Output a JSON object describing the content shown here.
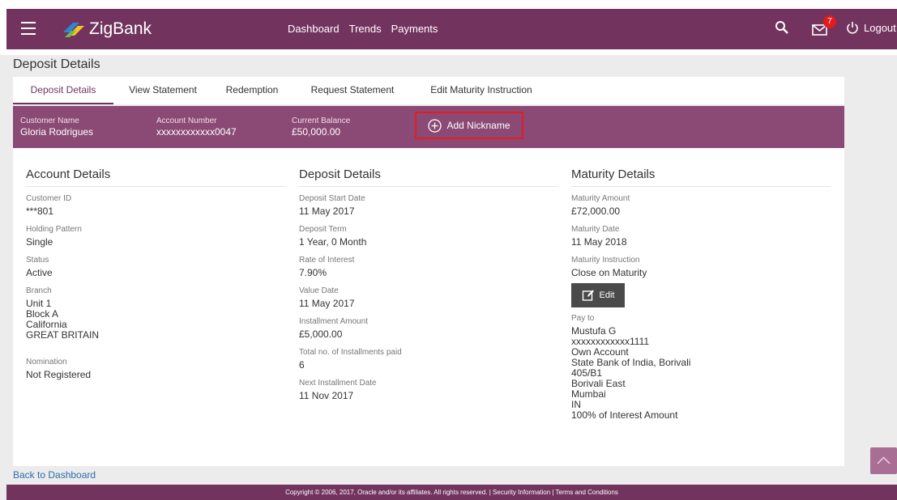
{
  "header": {
    "app_name": "ZigBank",
    "nav": [
      "Dashboard",
      "Trends",
      "Payments"
    ],
    "mail_badge": "7",
    "logout_label": "Logout",
    "brand_color": "#72345e"
  },
  "page_title": "Deposit Details",
  "tabs": [
    {
      "label": "Deposit Details",
      "active": true
    },
    {
      "label": "View Statement",
      "active": false
    },
    {
      "label": "Redemption",
      "active": false
    },
    {
      "label": "Request Statement",
      "active": false
    },
    {
      "label": "Edit Maturity Instruction",
      "active": false
    }
  ],
  "summary": {
    "customer_name_label": "Customer Name",
    "customer_name": "Gloria Rodrigues",
    "account_number_label": "Account Number",
    "account_number": "xxxxxxxxxxxx0047",
    "balance_label": "Current Balance",
    "balance": "£50,000.00",
    "add_nickname": "Add Nickname"
  },
  "account_details": {
    "title": "Account Details",
    "fields": [
      {
        "label": "Customer ID",
        "value": "***801"
      },
      {
        "label": "Holding Pattern",
        "value": "Single"
      },
      {
        "label": "Status",
        "value": "Active"
      }
    ],
    "branch_label": "Branch",
    "branch_lines": [
      "Unit 1",
      "Block A",
      "California",
      "GREAT BRITAIN"
    ],
    "nomination_label": "Nomination",
    "nomination": "Not Registered"
  },
  "deposit_details": {
    "title": "Deposit Details",
    "fields": [
      {
        "label": "Deposit Start Date",
        "value": "11 May 2017"
      },
      {
        "label": "Deposit Term",
        "value": "1 Year, 0 Month"
      },
      {
        "label": "Rate of Interest",
        "value": "7.90%"
      },
      {
        "label": "Value Date",
        "value": "11 May 2017"
      },
      {
        "label": "Installment Amount",
        "value": "£5,000.00"
      },
      {
        "label": "Total no. of Installments paid",
        "value": "6"
      },
      {
        "label": "Next Installment Date",
        "value": "11 Nov 2017"
      }
    ]
  },
  "maturity_details": {
    "title": "Maturity Details",
    "fields": [
      {
        "label": "Maturity Amount",
        "value": "£72,000.00"
      },
      {
        "label": "Maturity Date",
        "value": "11 May 2018"
      },
      {
        "label": "Maturity Instruction",
        "value": "Close on Maturity"
      }
    ],
    "edit_label": "Edit",
    "pay_to_label": "Pay to",
    "pay_to_lines": [
      "Mustufa G",
      "xxxxxxxxxxxx1111",
      "Own Account",
      "State Bank of India, Borivali",
      "405/B1",
      "Borivali East",
      "Mumbai",
      "IN",
      "100% of Interest Amount"
    ]
  },
  "back_link": "Back to Dashboard",
  "footer": "Copyright © 2006, 2017, Oracle and/or its affiliates. All rights reserved. | Security Information | Terms and Conditions"
}
